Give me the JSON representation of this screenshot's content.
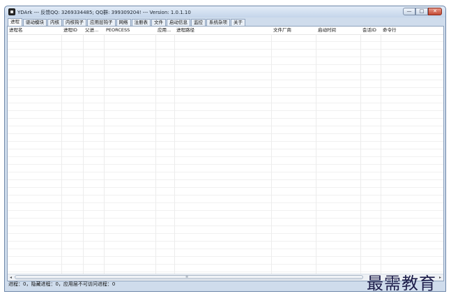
{
  "window": {
    "title": "YDArk --- 反馈QQ: 3269334485; QQ群: 399309204! --- Version: 1.0.1.10",
    "caption_buttons": {
      "minimize": "—",
      "maximize": "□",
      "close": "✕"
    }
  },
  "tabs": [
    {
      "label": "进程"
    },
    {
      "label": "驱动模块"
    },
    {
      "label": "内核"
    },
    {
      "label": "内核钩子"
    },
    {
      "label": "应用层钩子"
    },
    {
      "label": "网络"
    },
    {
      "label": "注册表"
    },
    {
      "label": "文件"
    },
    {
      "label": "启动信息"
    },
    {
      "label": "监控"
    },
    {
      "label": "系统杂项"
    },
    {
      "label": "关于"
    }
  ],
  "table": {
    "columns": [
      {
        "label": "进程名"
      },
      {
        "label": "进程ID"
      },
      {
        "label": "父进..."
      },
      {
        "label": "PEORCESS"
      },
      {
        "label": "应用..."
      },
      {
        "label": "进程路径"
      },
      {
        "label": "文件厂商"
      },
      {
        "label": "启动时间"
      },
      {
        "label": "会话ID"
      },
      {
        "label": "命令行"
      }
    ],
    "rows": []
  },
  "hscroll": {
    "grip": "≡",
    "left_arrow": "◂",
    "right_arrow": "▸"
  },
  "status": {
    "text": "进程：0，隐藏进程：0，应用层不可访问进程：0"
  },
  "watermark": {
    "text": "最需教育"
  }
}
